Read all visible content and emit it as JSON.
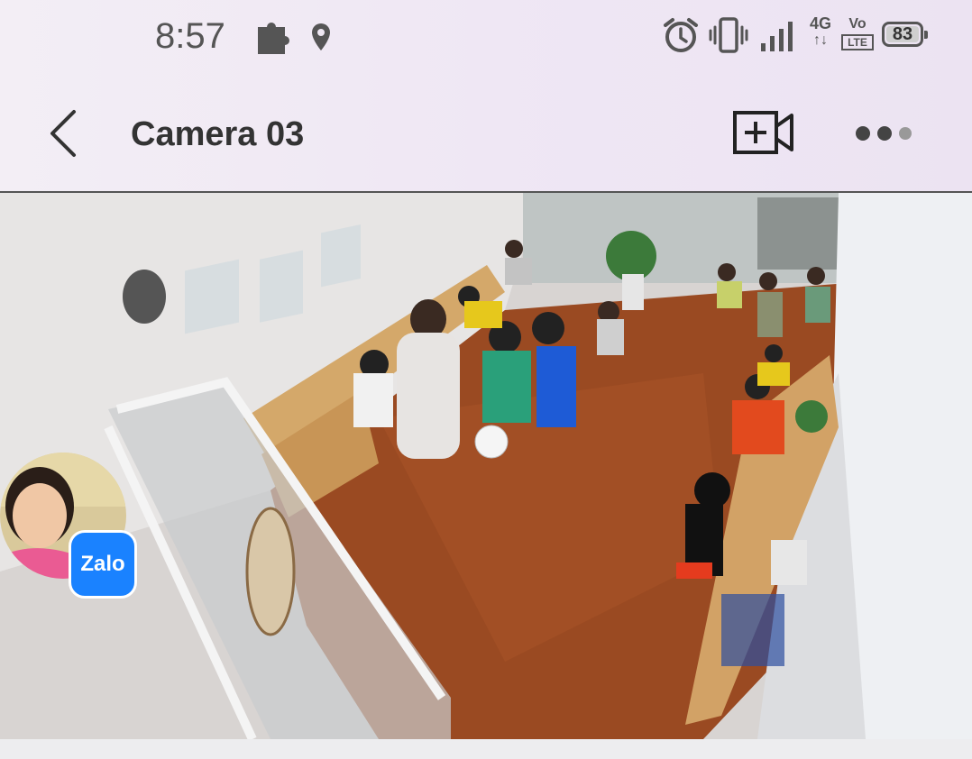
{
  "status_bar": {
    "time": "8:57",
    "network_label": "4G",
    "volte_label": "Vo",
    "lte_label": "LTE",
    "battery_percent": "83",
    "icons": [
      "puzzle-icon",
      "location-icon",
      "alarm-icon",
      "vibrate-icon",
      "signal-icon",
      "network-4g-icon",
      "volte-icon",
      "battery-icon"
    ]
  },
  "header": {
    "title": "Camera 03",
    "back_icon": "chevron-left-icon",
    "add_video_icon": "video-add-icon",
    "more_icon": "more-dots-icon"
  },
  "feed": {
    "content": "classroom-camera-view"
  },
  "overlay": {
    "app_badge": "Zalo"
  },
  "colors": {
    "background": "#efe7f4",
    "text": "#333333",
    "zalo_blue": "#1a82ff"
  }
}
